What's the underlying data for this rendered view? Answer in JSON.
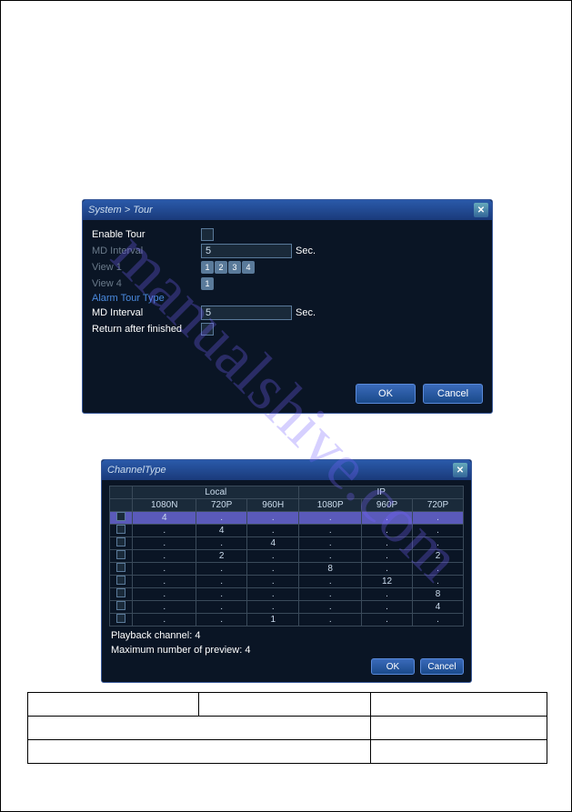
{
  "watermark": "manualshive.com",
  "dialog1": {
    "title": "System > Tour",
    "enable_tour": {
      "label": "Enable Tour"
    },
    "md_interval1": {
      "label": "MD Interval",
      "value": "5",
      "unit": "Sec."
    },
    "view1": {
      "label": "View 1",
      "opts": [
        "1",
        "2",
        "3",
        "4"
      ]
    },
    "view4": {
      "label": "View 4",
      "opts": [
        "1"
      ]
    },
    "alarm_section": "Alarm Tour Type",
    "md_interval2": {
      "label": "MD Interval",
      "value": "5",
      "unit": "Sec."
    },
    "return_after": {
      "label": "Return after finished"
    },
    "ok": "OK",
    "cancel": "Cancel"
  },
  "dialog2": {
    "title": "ChannelType",
    "groups": [
      "Local",
      "IP"
    ],
    "cols": [
      "1080N",
      "720P",
      "960H",
      "1080P",
      "960P",
      "720P"
    ],
    "rows": [
      [
        "4",
        ".",
        ".",
        ".",
        ".",
        "."
      ],
      [
        ".",
        "4",
        ".",
        ".",
        ".",
        "."
      ],
      [
        ".",
        ".",
        "4",
        ".",
        ".",
        "."
      ],
      [
        ".",
        "2",
        ".",
        ".",
        ".",
        "2"
      ],
      [
        ".",
        ".",
        ".",
        "8",
        ".",
        "."
      ],
      [
        ".",
        ".",
        ".",
        ".",
        "12",
        "."
      ],
      [
        ".",
        ".",
        ".",
        ".",
        ".",
        "8"
      ],
      [
        ".",
        ".",
        ".",
        ".",
        ".",
        "4"
      ],
      [
        ".",
        ".",
        "1",
        ".",
        ".",
        "."
      ]
    ],
    "playback": "Playback channel: 4",
    "max_preview": "Maximum number of preview: 4",
    "ok": "OK",
    "cancel": "Cancel"
  }
}
